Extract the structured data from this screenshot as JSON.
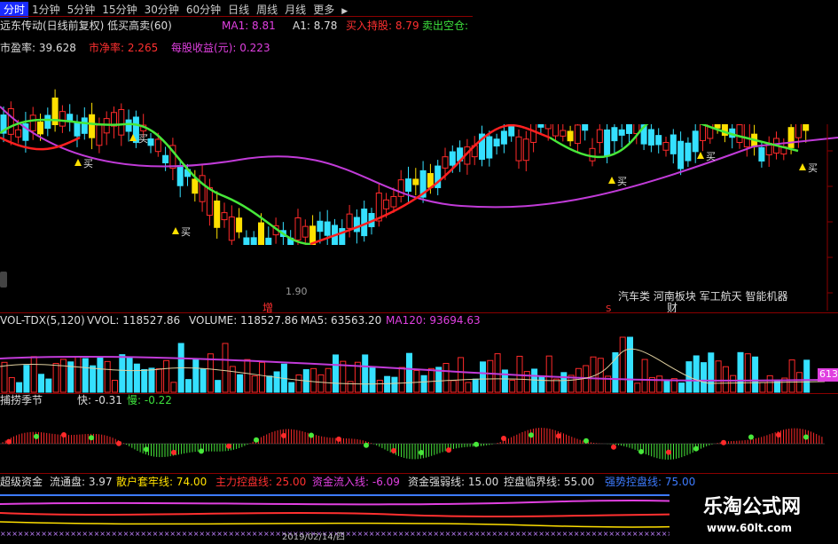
{
  "toolbar": {
    "items": [
      "分时",
      "1分钟",
      "5分钟",
      "15分钟",
      "30分钟",
      "60分钟",
      "日线",
      "周线",
      "月线",
      "更多"
    ],
    "active_index": 0,
    "arrow": "▶"
  },
  "main": {
    "title": "远东传动(日线前复权) 低买高卖(60)",
    "ma1_label": "MA1: 8.81",
    "a1_label": "A1: 8.78",
    "buy_label": "买入持股: 8.79",
    "sell_label": "卖出空仓:",
    "pe_label": "市盈率: 39.628",
    "pb_label": "市净率: 2.265",
    "eps_label": "每股收益(元): 0.223",
    "buy_marker": "买",
    "concepts": "汽车类 河南板块 军工航天 智能机器",
    "concept_tail": "财",
    "bottom_label_zeng": "增",
    "bottom_label_s": "S",
    "price_partial": "1.90",
    "colors": {
      "up": "#ff2a2a",
      "down": "#35e0ff",
      "yellow": "#ffe000",
      "ma_green": "#47e83a",
      "ma_magenta": "#c13bd8",
      "ma_red": "#ff2020"
    }
  },
  "vol": {
    "label_name": "VOL-TDX(5,120)",
    "vvol": "VVOL: 118527.86",
    "volume": "VOLUME: 118527.86",
    "ma5": "MA5: 63563.20",
    "ma120": "MA120: 93694.63",
    "axis_value": "613"
  },
  "season": {
    "name": "捕捞季节",
    "fast": "快: -0.31",
    "slow": "慢: -0.22"
  },
  "super": {
    "name": "超级资金",
    "float": "流通盘: 3.97",
    "retail": "散户套牢线: 74.00",
    "main_force": "主力控盘线: 25.00",
    "inflow": "资金流入线: -6.09",
    "strength": "资金强弱线: 15.00",
    "critical": "控盘临界线: 55.00",
    "strong": "强势控盘线: 75.00",
    "bottom_text": "2019/02/14/四"
  },
  "watermark": {
    "title": "乐淘公式网",
    "url": "www.60lt.com"
  }
}
